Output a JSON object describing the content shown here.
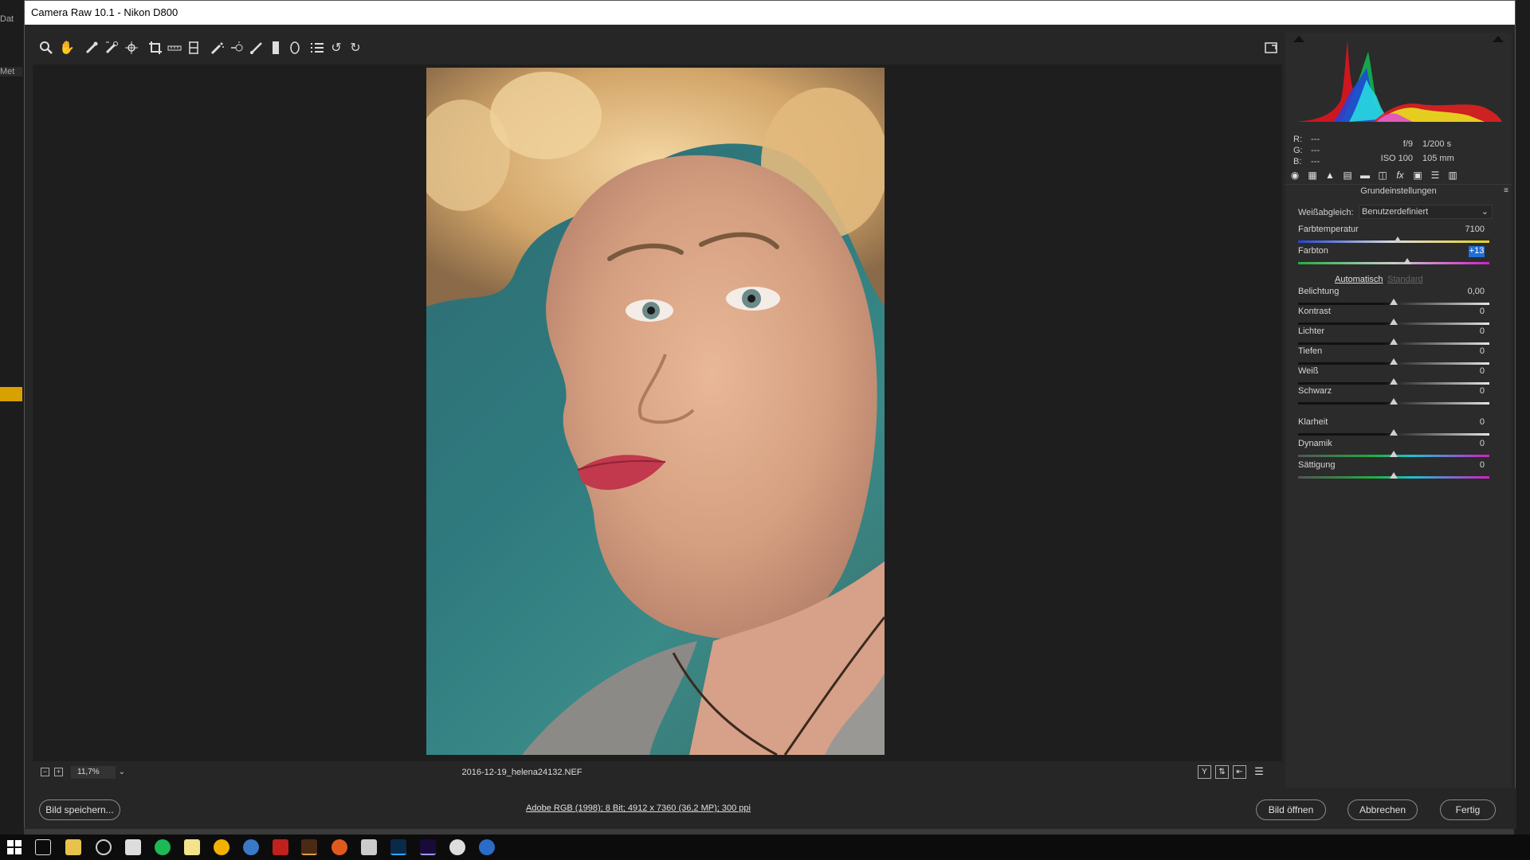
{
  "window": {
    "title": "Camera Raw 10.1 - Nikon D800"
  },
  "desktop": {
    "left_labels": [
      "Dat",
      "Met"
    ]
  },
  "toolbar": {
    "tools": [
      "zoom-icon",
      "hand-icon",
      "white-balance-icon",
      "color-sampler-icon",
      "targeted-adjustment-icon",
      "crop-icon",
      "straighten-icon",
      "transform-icon",
      "spot-removal-icon",
      "red-eye-icon",
      "adjustment-brush-icon",
      "graduated-filter-icon",
      "radial-filter-icon",
      "preferences-list-icon",
      "rotate-left-icon",
      "rotate-right-icon"
    ],
    "fullscreen": "fullscreen-icon"
  },
  "statusbar": {
    "zoom": "11,7%",
    "filename": "2016-12-19_helena24132.NEF"
  },
  "info": {
    "r_label": "R:",
    "r_value": "---",
    "g_label": "G:",
    "g_value": "---",
    "b_label": "B:",
    "b_value": "---",
    "aperture": "f/9",
    "shutter": "1/200 s",
    "iso": "ISO 100",
    "focal": "105 mm"
  },
  "panel": {
    "title": "Grundeinstellungen",
    "wb_label": "Weißabgleich:",
    "wb_value": "Benutzerdefiniert",
    "auto": "Automatisch",
    "standard": "Standard",
    "sliders": [
      {
        "label": "Farbtemperatur",
        "value": "7100",
        "pos": 0.52
      },
      {
        "label": "Farbton",
        "value": "+13",
        "pos": 0.57
      },
      {
        "label": "Belichtung",
        "value": "0,00",
        "pos": 0.5
      },
      {
        "label": "Kontrast",
        "value": "0",
        "pos": 0.5
      },
      {
        "label": "Lichter",
        "value": "0",
        "pos": 0.5
      },
      {
        "label": "Tiefen",
        "value": "0",
        "pos": 0.5
      },
      {
        "label": "Weiß",
        "value": "0",
        "pos": 0.5
      },
      {
        "label": "Schwarz",
        "value": "0",
        "pos": 0.5
      },
      {
        "label": "Klarheit",
        "value": "0",
        "pos": 0.5
      },
      {
        "label": "Dynamik",
        "value": "0",
        "pos": 0.5
      },
      {
        "label": "Sättigung",
        "value": "0",
        "pos": 0.5
      }
    ]
  },
  "bottom": {
    "save": "Bild speichern...",
    "workflow": "Adobe RGB (1998); 8 Bit; 4912 x 7360 (36,2 MP); 300 ppi",
    "open": "Bild öffnen",
    "cancel": "Abbrechen",
    "done": "Fertig"
  },
  "colors": {
    "accent": "#2f7a7e",
    "highlight": "#1e6fd6"
  }
}
